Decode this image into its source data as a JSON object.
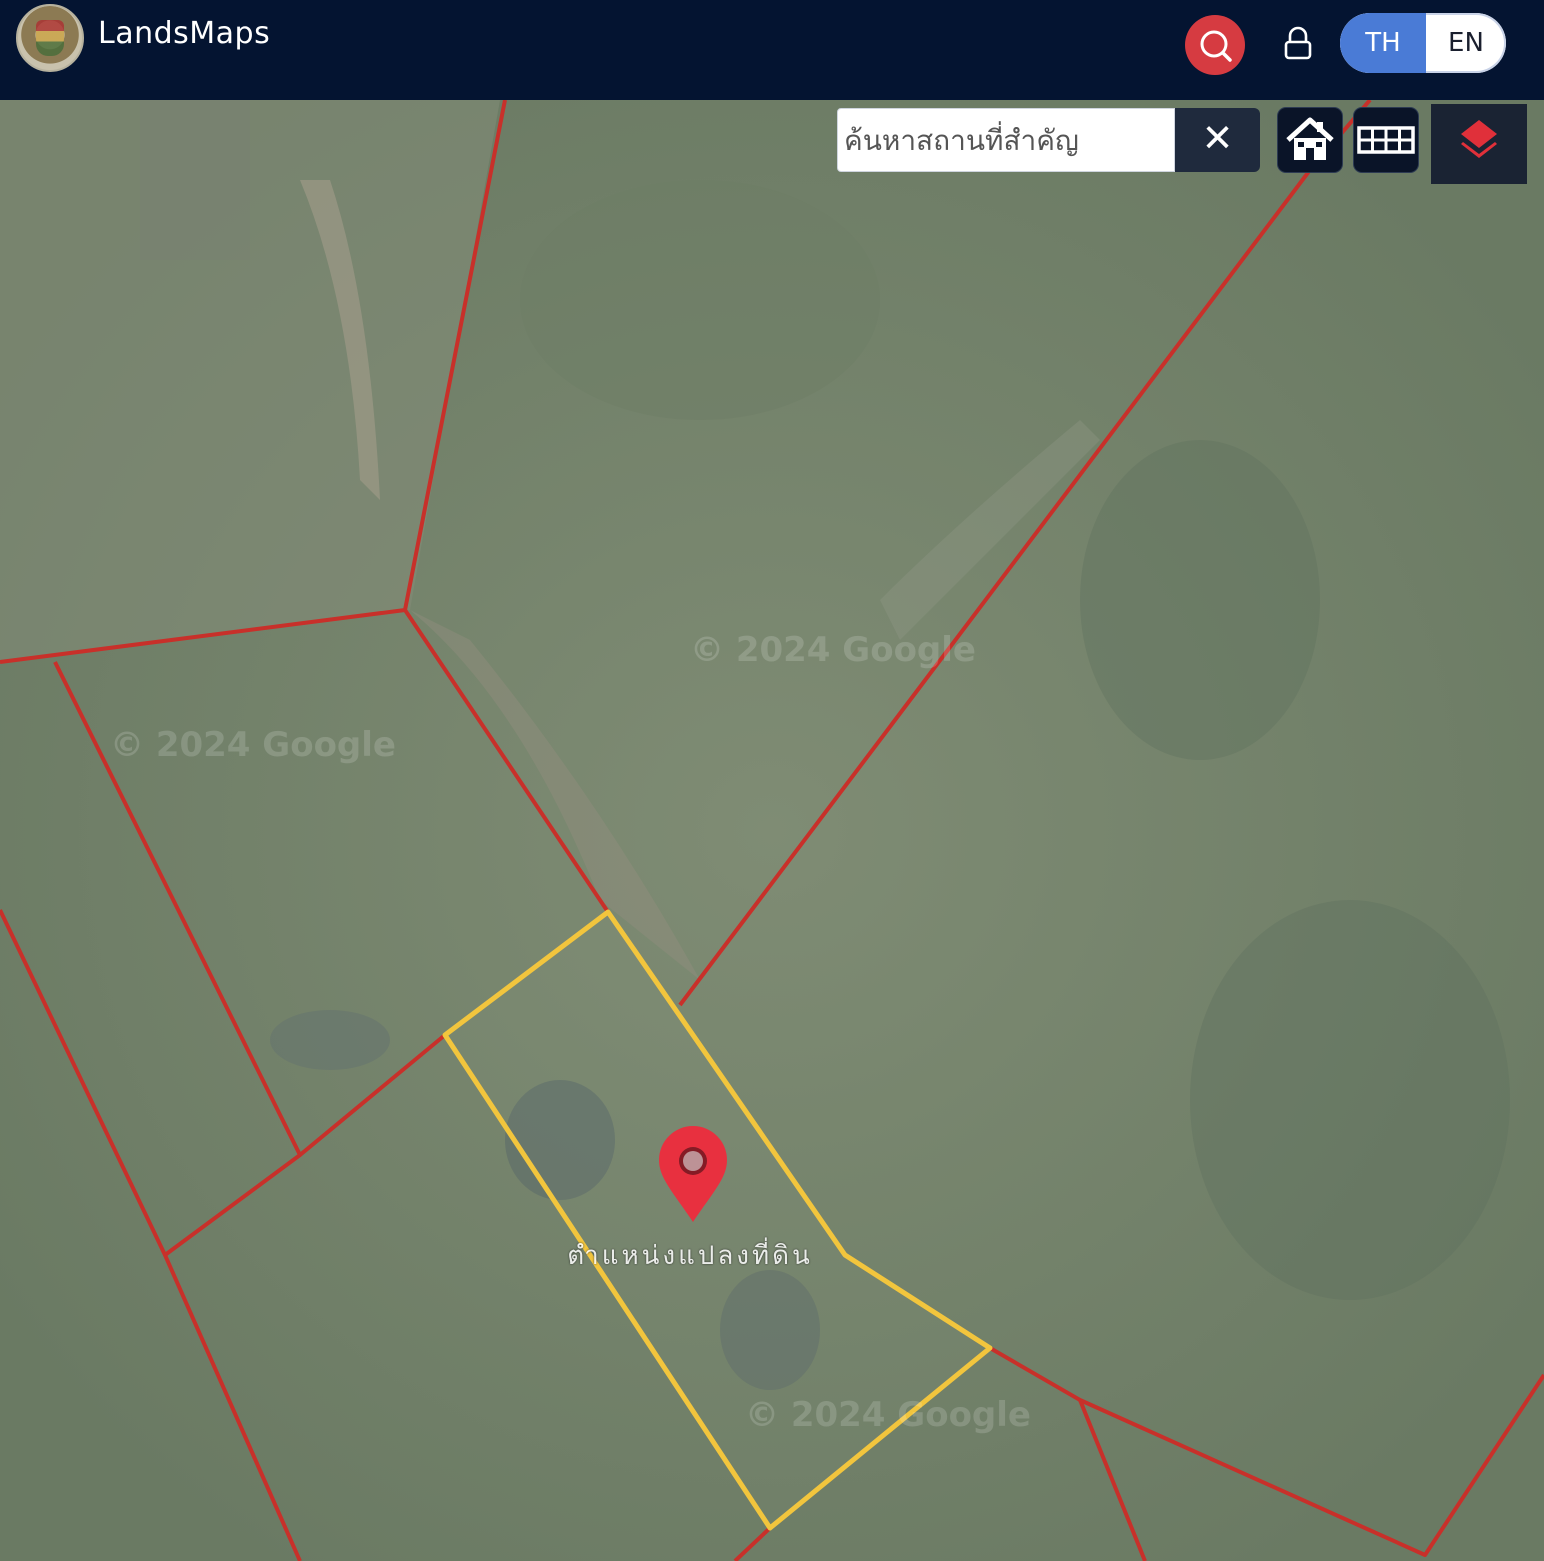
{
  "app": {
    "brand": "LandsMaps"
  },
  "header": {
    "lang_th": "TH",
    "lang_en": "EN",
    "active_lang": "TH"
  },
  "map": {
    "search": {
      "placeholder": "ค้นหาสถานที่สำคัญ",
      "value": "",
      "clear_symbol": "✕"
    },
    "marker_label": "ตำแหน่งแปลงที่ดิน",
    "watermark": "© 2024 Google"
  },
  "colors": {
    "navbar": "#041431",
    "accent_red": "#d63b41",
    "lang_active": "#4a7bd6",
    "parcel_boundary": "#c8302a",
    "selected_parcel": "#f2c53d",
    "marker": "#e8303f"
  },
  "icons": {
    "search": "search-icon",
    "lock": "lock-icon",
    "home": "home-icon",
    "grid": "grid-icon",
    "layers": "layers-icon",
    "marker": "map-pin-icon"
  }
}
